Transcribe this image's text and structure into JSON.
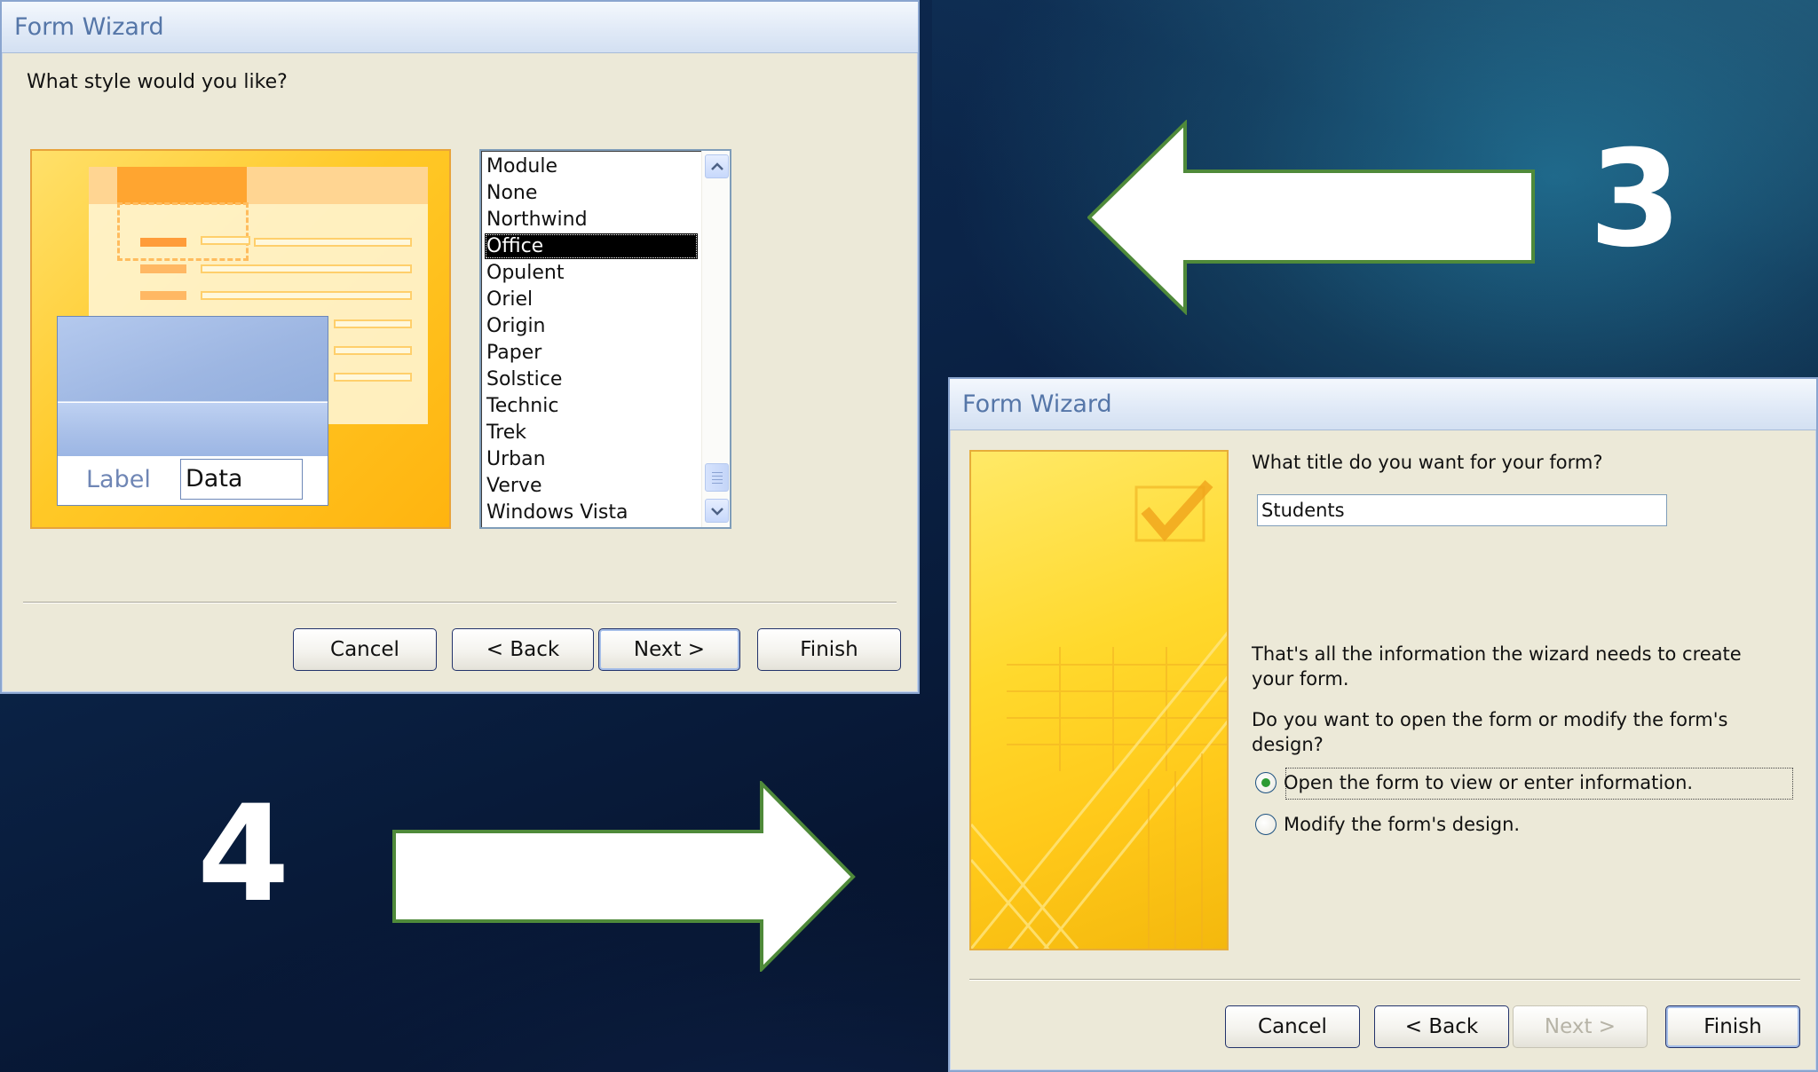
{
  "dialog1": {
    "title": "Form Wizard",
    "question": "What style would you like?",
    "preview": {
      "label": "Label",
      "data": "Data"
    },
    "styles": [
      "Module",
      "None",
      "Northwind",
      "Office",
      "Opulent",
      "Oriel",
      "Origin",
      "Paper",
      "Solstice",
      "Technic",
      "Trek",
      "Urban",
      "Verve",
      "Windows Vista"
    ],
    "selected_style": "Office",
    "buttons": {
      "cancel": "Cancel",
      "back": "< Back",
      "next": "Next >",
      "finish": "Finish"
    }
  },
  "dialog2": {
    "title": "Form Wizard",
    "question": "What title do you want for your form?",
    "form_title_value": "Students",
    "info_text": "That's all the information the wizard needs to create your form.",
    "prompt_text": "Do you want to open the form or modify the form's design?",
    "options": [
      {
        "label": "Open the form to view or enter information.",
        "selected": true
      },
      {
        "label": "Modify the form's design.",
        "selected": false
      }
    ],
    "buttons": {
      "cancel": "Cancel",
      "back": "< Back",
      "next": "Next >",
      "finish": "Finish"
    },
    "next_disabled": true
  },
  "annotations": {
    "step_3": "3",
    "step_4": "4",
    "arrow_color": "#ffffff",
    "arrow_outline": "#4f8a3a"
  }
}
